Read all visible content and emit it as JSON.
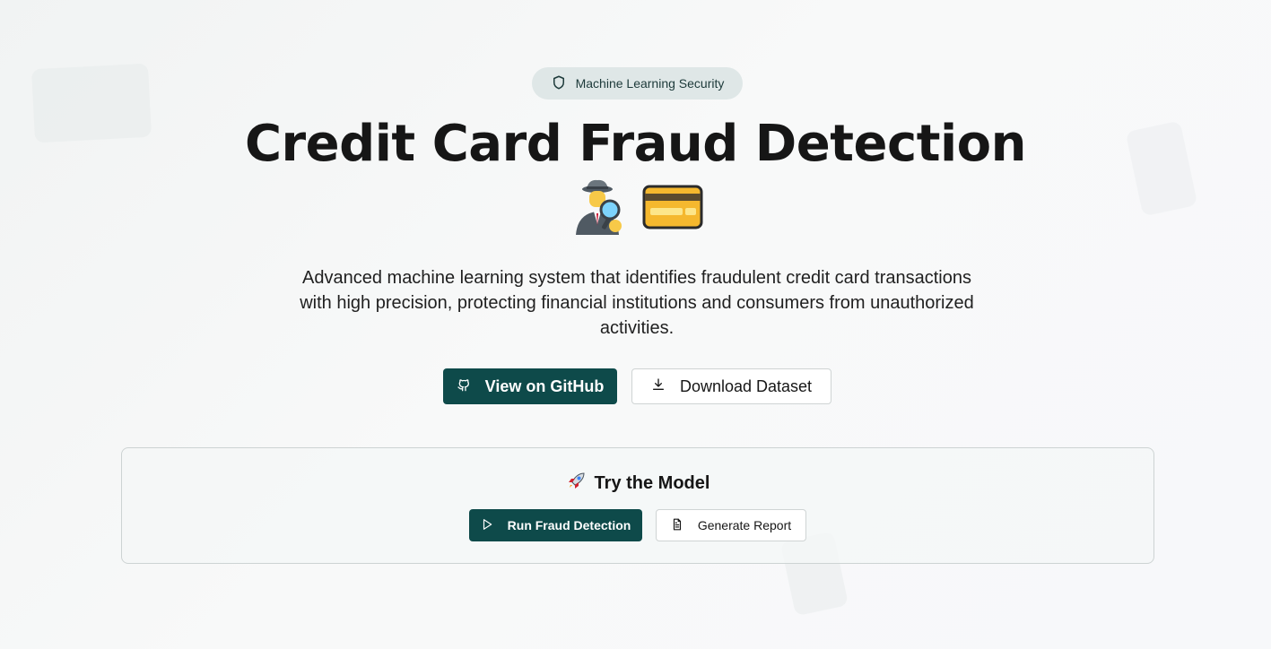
{
  "badge": {
    "label": "Machine Learning Security",
    "icon": "shield-icon"
  },
  "hero": {
    "title": "Credit Card Fraud Detection",
    "emojis": [
      "detective-icon",
      "credit-card-icon"
    ],
    "description": "Advanced machine learning system that identifies fraudulent credit card transactions with high precision, protecting financial institutions and consumers from unauthorized activities."
  },
  "actions": {
    "github": {
      "label": "View on GitHub",
      "icon": "github-icon"
    },
    "download": {
      "label": "Download Dataset",
      "icon": "download-icon"
    }
  },
  "try_model": {
    "title": "Try the Model",
    "title_icon": "rocket-icon",
    "run": {
      "label": "Run Fraud Detection",
      "icon": "play-icon"
    },
    "report": {
      "label": "Generate Report",
      "icon": "document-icon"
    }
  },
  "colors": {
    "primary": "#0e4a4a",
    "badge_bg": "#dfe7e7",
    "text": "#161616"
  }
}
